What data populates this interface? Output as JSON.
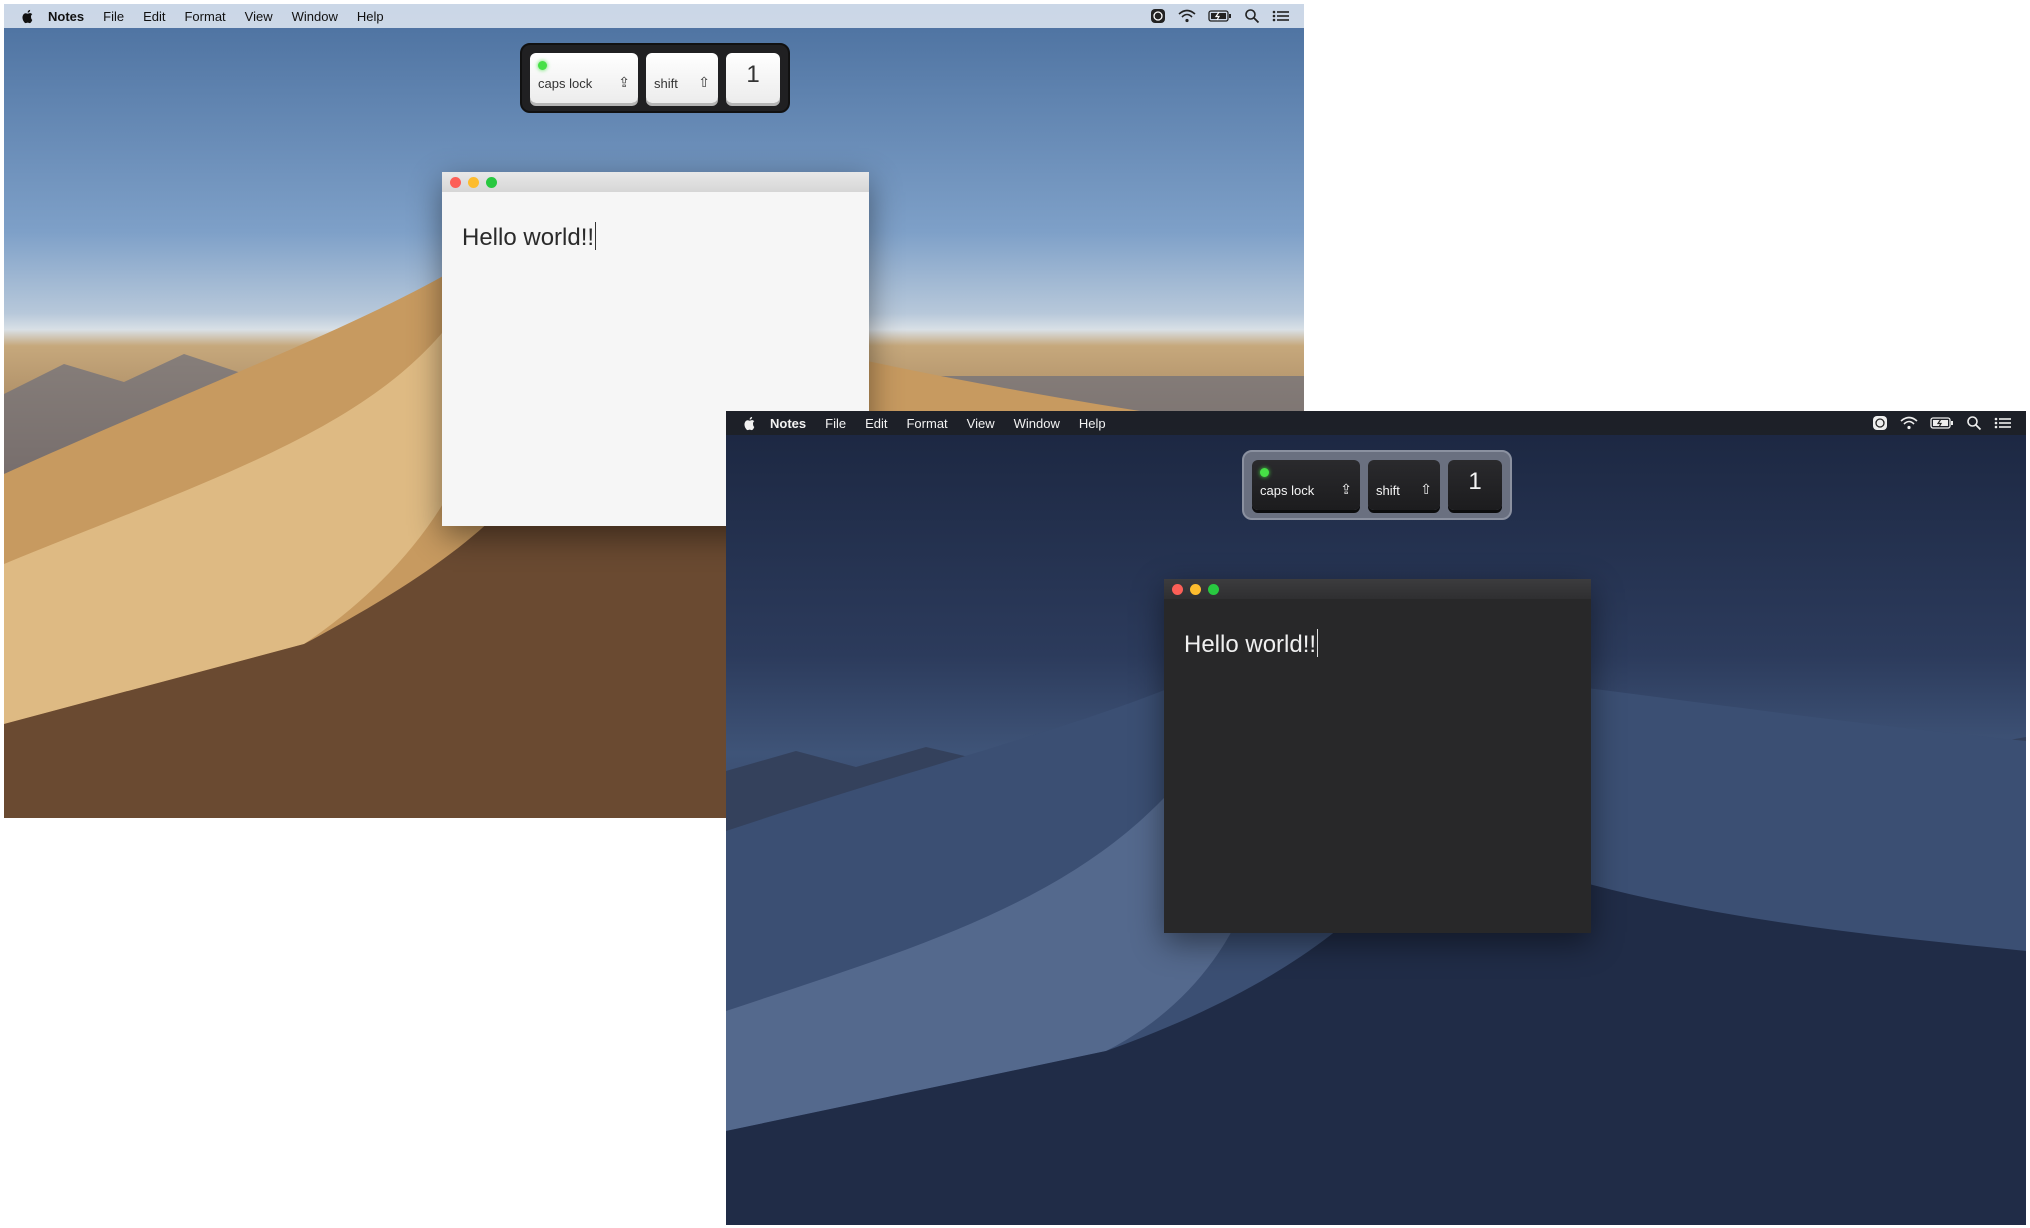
{
  "menubar": {
    "app_name": "Notes",
    "items": [
      "File",
      "Edit",
      "Format",
      "View",
      "Window",
      "Help"
    ]
  },
  "keys": {
    "caps_lock": {
      "label": "caps lock",
      "glyph": "⇪"
    },
    "shift": {
      "label": "shift",
      "glyph": "⇧"
    },
    "digit": {
      "label": "1"
    }
  },
  "note": {
    "text": "Hello world!!"
  },
  "icons": [
    "apple-icon",
    "globe-icon",
    "wifi-icon",
    "battery-icon",
    "search-icon",
    "list-icon",
    "caps-lock-icon",
    "shift-icon"
  ],
  "colors": {
    "led": "#46e046",
    "close": "#fc5f57",
    "minimize": "#fdbc2e",
    "maximize": "#28c840"
  }
}
